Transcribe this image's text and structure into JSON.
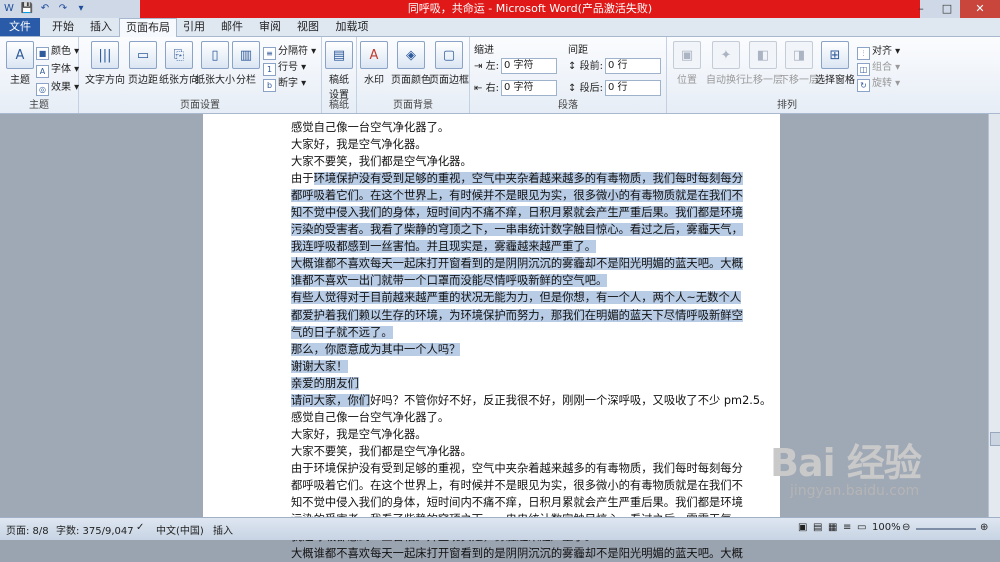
{
  "title_bar": {
    "text": "同呼吸，共命运 - Microsoft Word(产品激活失败)",
    "quick_access": [
      "W",
      "💾",
      "↶",
      "↷",
      "▾"
    ],
    "controls": {
      "minimize": "–",
      "maximize": "□",
      "close": "✕"
    }
  },
  "tabs": [
    {
      "label": "文件"
    },
    {
      "label": "开始"
    },
    {
      "label": "插入"
    },
    {
      "label": "页面布局"
    },
    {
      "label": "引用"
    },
    {
      "label": "邮件"
    },
    {
      "label": "审阅"
    },
    {
      "label": "视图"
    },
    {
      "label": "加载项"
    }
  ],
  "ribbon": {
    "groups": {
      "theme": "主题",
      "page_setup": "页面设置",
      "manuscript": "稿纸",
      "page_background": "页面背景",
      "paragraph": "段落",
      "arrange": "排列"
    },
    "theme": {
      "big": "主题",
      "colors": "颜色 ▾",
      "fonts": "字体 ▾",
      "effects": "效果 ▾"
    },
    "page_setup": {
      "text_direction": "文字方向",
      "margins": "页边距",
      "orientation": "纸张方向",
      "size": "纸张大小",
      "columns": "分栏",
      "breaks": "分隔符 ▾",
      "line_numbers": "行号 ▾",
      "hyphenation": "断字 ▾"
    },
    "manuscript": {
      "setup": "稿纸\n设置"
    },
    "page_background": {
      "watermark": "水印",
      "page_color": "页面颜色",
      "page_borders": "页面边框"
    },
    "paragraph": {
      "indent_label": "缩进",
      "left_label": "左:",
      "left_value": "0 字符",
      "right_label": "右:",
      "right_value": "0 字符",
      "spacing_label": "间距",
      "before_label": "段前:",
      "before_value": "0 行",
      "after_label": "段后:",
      "after_value": "0 行"
    },
    "arrange": {
      "position": "位置",
      "wrap": "自动换行",
      "bring_forward": "上移一层",
      "send_backward": "下移一层",
      "selection_pane": "选择窗格",
      "align": "对齐 ▾",
      "group": "组合 ▾",
      "rotate": "旋转 ▾"
    }
  },
  "document": {
    "lines": [
      {
        "pre": "感觉自己像一台空气净化器了。",
        "sel": "",
        "post": ""
      },
      {
        "pre": "大家好，我是空气净化器。",
        "sel": "",
        "post": ""
      },
      {
        "pre": "大家不要笑，我们都是空气净化器。",
        "sel": "",
        "post": ""
      },
      {
        "pre": "由于",
        "sel": "环境保护没有受到足够的重视，空气中夹杂着越来越多的有毒物质，我们每时每刻每分",
        "post": ""
      },
      {
        "pre": "",
        "sel": "都呼吸着它们。在这个世界上，有时候并不是眼见为实，很多微小的有毒物质就是在我们不",
        "post": ""
      },
      {
        "pre": "",
        "sel": "知不觉中侵入我们的身体，短时间内不痛不痒，日积月累就会产生严重后果。我们都是环境",
        "post": ""
      },
      {
        "pre": "",
        "sel": "污染的受害者。我看了柴静的穹顶之下，一串串统计数字触目惊心。看过之后，雾霾天气，",
        "post": ""
      },
      {
        "pre": "",
        "sel": "我连呼吸都感到一丝害怕。并且现实是，雾霾越来越严重了。",
        "post": ""
      },
      {
        "pre": "",
        "sel": "大概谁都不喜欢每天一起床打开窗看到的是阴阴沉沉的雾霾却不是阳光明媚的蓝天吧。大概",
        "post": ""
      },
      {
        "pre": "",
        "sel": "谁都不喜欢一出门就带一个口罩而没能尽情呼吸新鲜的空气吧。",
        "post": ""
      },
      {
        "pre": "",
        "sel": "有些人觉得对于目前越来越严重的状况无能为力，但是你想，有一个人，两个人~无数个人",
        "post": ""
      },
      {
        "pre": "",
        "sel": "都爱护着我们赖以生存的环境，为环境保护而努力，那我们在明媚的蓝天下尽情呼吸新鲜空",
        "post": ""
      },
      {
        "pre": "",
        "sel": "气的日子就不远了。",
        "post": ""
      },
      {
        "pre": "",
        "sel": "那么，你愿意成为其中一个人吗？",
        "post": ""
      },
      {
        "pre": "",
        "sel": "谢谢大家！",
        "post": ""
      },
      {
        "pre": "",
        "sel": "亲爱的朋友们",
        "post": ""
      },
      {
        "pre": "",
        "sel": "请问大家，你们",
        "post": "好吗？不管你好不好，反正我很不好，刚刚一个深呼吸，又吸收了不少 pm2.5。"
      },
      {
        "pre": "感觉自己像一台空气净化器了。",
        "sel": "",
        "post": ""
      },
      {
        "pre": "大家好，我是空气净化器。",
        "sel": "",
        "post": ""
      },
      {
        "pre": "大家不要笑，我们都是空气净化器。",
        "sel": "",
        "post": ""
      },
      {
        "pre": "由于环境保护没有受到足够的重视，空气中夹杂着越来越多的有毒物质，我们每时每刻每分",
        "sel": "",
        "post": ""
      },
      {
        "pre": "都呼吸着它们。在这个世界上，有时候并不是眼见为实，很多微小的有毒物质就是在我们不",
        "sel": "",
        "post": ""
      },
      {
        "pre": "知不觉中侵入我们的身体，短时间内不痛不痒，日积月累就会产生严重后果。我们都是环境",
        "sel": "",
        "post": ""
      },
      {
        "pre": "污染的受害者。我看了柴静的穹顶之下，一串串统计数字触目惊心。看过之后，雾霾天气，",
        "sel": "",
        "post": ""
      },
      {
        "pre": "我连呼吸都感到一丝害怕。并且现实是，雾霾越来越严重了。",
        "sel": "",
        "post": ""
      },
      {
        "pre": "大概谁都不喜欢每天一起床打开窗看到的是阴阴沉沉的雾霾却不是阳光明媚的蓝天吧。大概",
        "sel": "",
        "post": ""
      }
    ]
  },
  "status": {
    "page": "页面: 8/8",
    "words": "字数: 375/9,047",
    "language": "中文(中国)",
    "mode": "插入",
    "zoom": "100%"
  },
  "watermark": {
    "logo": "Bai 经验",
    "url": "jingyan.baidu.com"
  }
}
